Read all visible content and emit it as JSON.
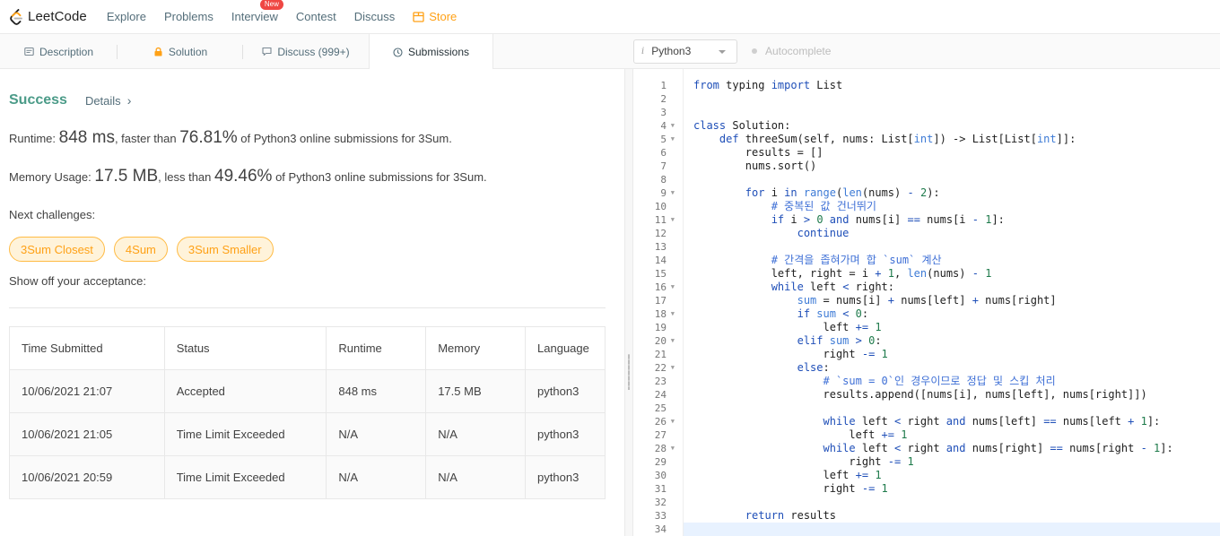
{
  "nav": {
    "logo": "LeetCode",
    "items": [
      "Explore",
      "Problems",
      "Interview",
      "Contest",
      "Discuss"
    ],
    "new_badge": "New",
    "store": "Store"
  },
  "tabs": [
    "Description",
    "Solution",
    "Discuss (999+)",
    "Submissions"
  ],
  "editor_header": {
    "language": "Python3",
    "autocomplete": "Autocomplete"
  },
  "result": {
    "status": "Success",
    "details": "Details",
    "details_arrow": "›",
    "runtime_label": "Runtime: ",
    "runtime_value": "848 ms",
    "runtime_mid": ", faster than ",
    "runtime_pct": "76.81%",
    "runtime_tail": " of Python3 online submissions for 3Sum.",
    "memory_label": "Memory Usage: ",
    "memory_value": "17.5 MB",
    "memory_mid": ", less than ",
    "memory_pct": "49.46%",
    "memory_tail": " of Python3 online submissions for 3Sum.",
    "next_label": "Next challenges:",
    "challenges": [
      "3Sum Closest",
      "4Sum",
      "3Sum Smaller"
    ],
    "show_off": "Show off your acceptance:"
  },
  "table": {
    "headers": [
      "Time Submitted",
      "Status",
      "Runtime",
      "Memory",
      "Language"
    ],
    "rows": [
      {
        "time": "10/06/2021 21:07",
        "status": "Accepted",
        "runtime": "848 ms",
        "memory": "17.5 MB",
        "language": "python3"
      },
      {
        "time": "10/06/2021 21:05",
        "status": "Time Limit Exceeded",
        "runtime": "N/A",
        "memory": "N/A",
        "language": "python3"
      },
      {
        "time": "10/06/2021 20:59",
        "status": "Time Limit Exceeded",
        "runtime": "N/A",
        "memory": "N/A",
        "language": "python3"
      }
    ]
  },
  "colors": {
    "accent": "#ffa116",
    "success": "#4b9b88",
    "error": "#c03a3a"
  },
  "code": {
    "folded_lines": [
      4,
      5,
      9,
      11,
      16,
      18,
      20,
      22,
      26,
      28
    ],
    "lines": [
      "from typing import List",
      "",
      "",
      "class Solution:",
      "    def threeSum(self, nums: List[int]) -> List[List[int]]:",
      "        results = []",
      "        nums.sort()",
      "",
      "        for i in range(len(nums) - 2):",
      "            # 중복된 값 건너뛰기",
      "            if i > 0 and nums[i] == nums[i - 1]:",
      "                continue",
      "",
      "            # 간격을 좁혀가며 합 `sum` 계산",
      "            left, right = i + 1, len(nums) - 1",
      "            while left < right:",
      "                sum = nums[i] + nums[left] + nums[right]",
      "                if sum < 0:",
      "                    left += 1",
      "                elif sum > 0:",
      "                    right -= 1",
      "                else:",
      "                    # `sum = 0`인 경우이므로 정답 및 스킵 처리",
      "                    results.append([nums[i], nums[left], nums[right]])",
      "",
      "                    while left < right and nums[left] == nums[left + 1]:",
      "                        left += 1",
      "                    while left < right and nums[right] == nums[right - 1]:",
      "                        right -= 1",
      "                    left += 1",
      "                    right -= 1",
      "",
      "        return results",
      ""
    ]
  }
}
